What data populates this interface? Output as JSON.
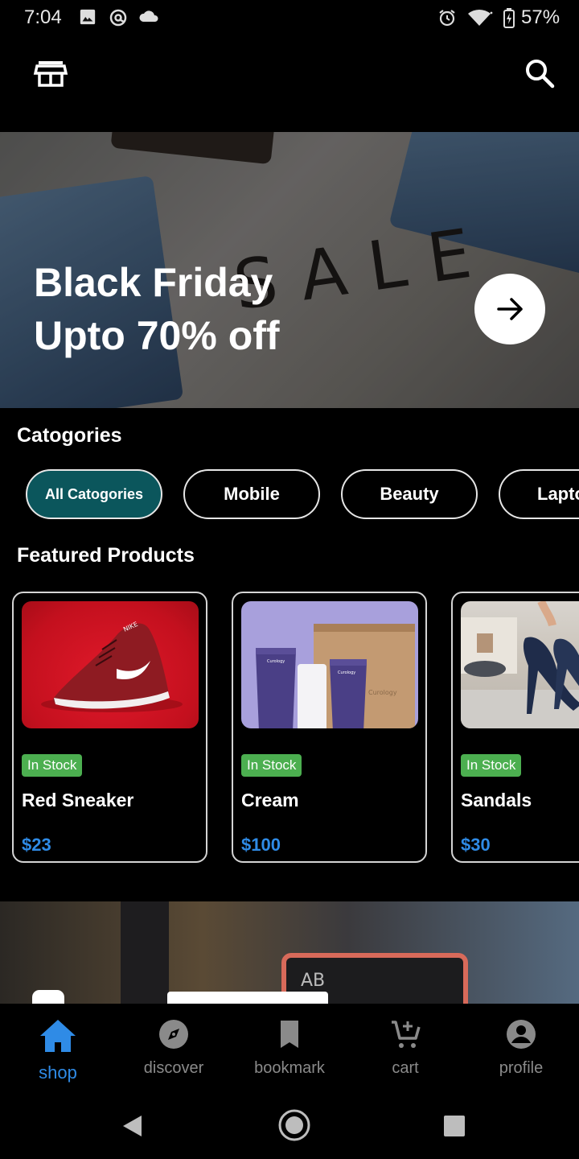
{
  "status_bar": {
    "time": "7:04",
    "battery": "57%",
    "icons": [
      "image-icon",
      "at-sign-icon",
      "cloud-icon",
      "alarm-icon",
      "wifi-icon",
      "battery-charging-icon"
    ]
  },
  "app_bar": {
    "left_icon": "store-icon",
    "right_icon": "search-icon"
  },
  "hero": {
    "line1": "Black Friday",
    "line2": "Upto 70% off",
    "sign_text": "SALE",
    "action_icon": "arrow-right-icon"
  },
  "categories": {
    "title": "Catogories",
    "items": [
      {
        "label": "All Catogories",
        "active": true
      },
      {
        "label": "Mobile",
        "active": false
      },
      {
        "label": "Beauty",
        "active": false
      },
      {
        "label": "Laptops",
        "active": false
      }
    ]
  },
  "featured": {
    "title": "Featured Products",
    "products": [
      {
        "badge": "In Stock",
        "name": "Red Sneaker",
        "price": "$23",
        "brand_text": "NIKE"
      },
      {
        "badge": "In Stock",
        "name": "Cream",
        "price": "$100",
        "brand_text": "Curology"
      },
      {
        "badge": "In Stock",
        "name": "Sandals",
        "price": "$30"
      }
    ]
  },
  "second_banner": {
    "sign_text": "AB"
  },
  "bottom_nav": {
    "items": [
      {
        "label": "shop",
        "icon": "home-icon",
        "active": true
      },
      {
        "label": "discover",
        "icon": "compass-icon",
        "active": false
      },
      {
        "label": "bookmark",
        "icon": "bookmark-icon",
        "active": false
      },
      {
        "label": "cart",
        "icon": "cart-add-icon",
        "active": false
      },
      {
        "label": "profile",
        "icon": "account-circle-icon",
        "active": false
      }
    ]
  },
  "colors": {
    "accent": "#2f8be6",
    "chip_active": "#0b565c",
    "stock_badge": "#4caf50",
    "background": "#000000"
  }
}
